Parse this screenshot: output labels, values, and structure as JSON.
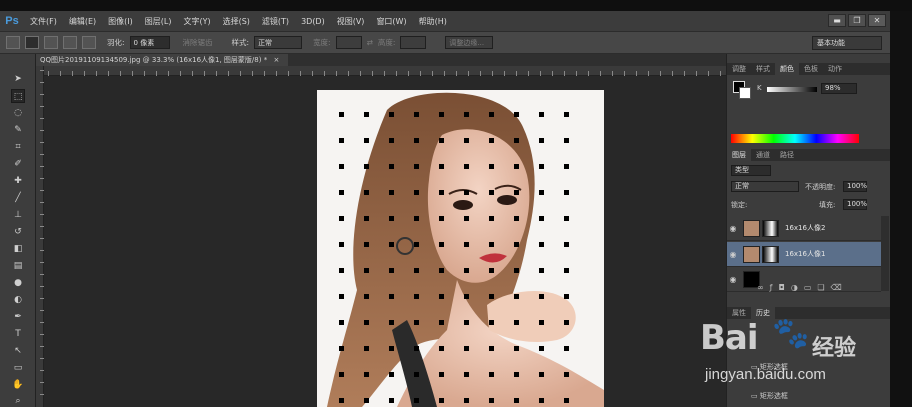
{
  "app": {
    "logo": "Ps"
  },
  "menu": [
    "文件(F)",
    "编辑(E)",
    "图像(I)",
    "图层(L)",
    "文字(Y)",
    "选择(S)",
    "滤镜(T)",
    "3D(D)",
    "视图(V)",
    "窗口(W)",
    "帮助(H)"
  ],
  "window_controls": {
    "minimize": "▬",
    "restore": "❐",
    "close": "✕"
  },
  "options_bar": {
    "feather_label": "羽化:",
    "feather_value": "0 像素",
    "antialias_label": "消除锯齿",
    "style_label": "样式:",
    "style_value": "正常",
    "width_label": "宽度:",
    "height_label": "高度:",
    "refine_edge_label": "调整边缘...",
    "workspace": "基本功能"
  },
  "document": {
    "tab_title": "QQ图片20191109134509.jpg @ 33.3% (16x16人像1, 图层蒙版/8) *",
    "tab_close": "×"
  },
  "panels": {
    "color_tabs": [
      "调整",
      "样式",
      "颜色",
      "色板",
      "动作"
    ],
    "color_active": "颜色",
    "color_channel_label": "K",
    "color_value": "98",
    "color_unit": "%",
    "layers_tabs": [
      "图层",
      "通道",
      "路径"
    ],
    "layers_active": "图层",
    "filter_kind": "类型",
    "blend_mode": "正常",
    "opacity_label": "不透明度:",
    "opacity_value": "100%",
    "lock_label": "锁定:",
    "fill_label": "填充:",
    "fill_value": "100%",
    "layers": [
      {
        "name": "16x16人像2",
        "selected": false
      },
      {
        "name": "16x16人像1",
        "selected": true
      },
      {
        "name": "",
        "selected": false
      }
    ],
    "history_tabs": [
      "属性",
      "历史"
    ],
    "history_items": [
      "矩形选框",
      "矩形选框"
    ]
  },
  "watermark": {
    "brand": "Bai",
    "brand_cn": "经验",
    "url": "jingyan.baidu.com"
  },
  "colors": {
    "accent_blue": "#4a9bdc",
    "selection_blue": "#5b6f8a",
    "canvas_bg": "#f6f4f2",
    "pasteboard": "#282828"
  }
}
